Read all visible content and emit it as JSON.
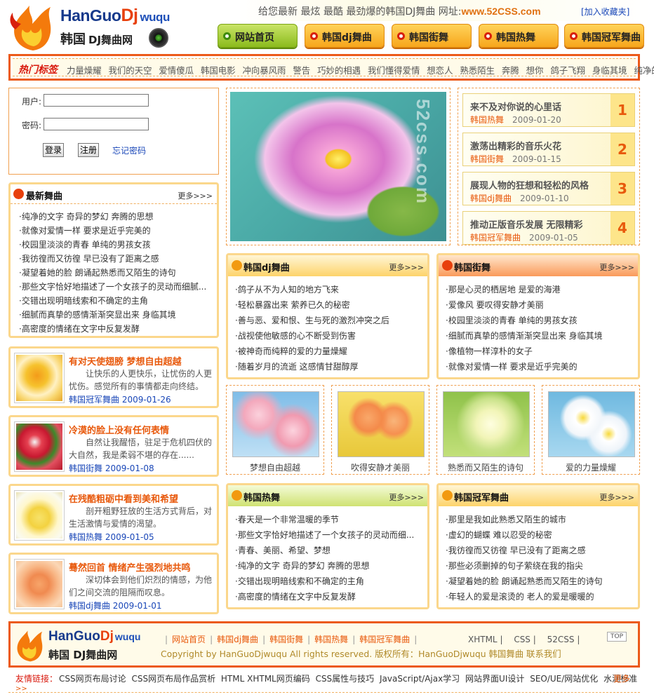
{
  "header": {
    "logo_en_main": "HanGuo",
    "logo_en_dj": "Dj",
    "logo_en_tail": "wuqu",
    "logo_cn": "韩国",
    "logo_cn_small": "DJ舞曲网",
    "slogan": "给您最新 最炫 最酷 最劲爆的韩国DJ舞曲  网址:",
    "site_url": "www.52CSS.com",
    "favorite": "[加入收藏夹]"
  },
  "nav": {
    "items": [
      {
        "label": "网站首页",
        "active": true
      },
      {
        "label": "韩国dj舞曲",
        "active": false
      },
      {
        "label": "韩国街舞",
        "active": false
      },
      {
        "label": "韩国热舞",
        "active": false
      },
      {
        "label": "韩国冠军舞曲",
        "active": false
      }
    ]
  },
  "hot_tags": {
    "title": "热门标签",
    "tags": [
      "力量燥耀",
      "我们的天空",
      "爱情傻瓜",
      "韩国电影",
      "冲向暴风雨",
      "警告",
      "巧妙的相遇",
      "我们懂得爱情",
      "想恋人",
      "熟悉陌生",
      "奔腾",
      "想你",
      "鸽子飞翔",
      "身临其境",
      "纯净的文字"
    ]
  },
  "login": {
    "user_label": "用户:",
    "pass_label": "密码:",
    "login_btn": "登录",
    "register_btn": "注册",
    "forgot": "忘记密码"
  },
  "latest": {
    "title": "最新舞曲",
    "more": "更多>>>",
    "items": [
      "·纯净的文字 奇异的梦幻 奔腾的思想",
      "·就像对爱情一样 要求是近乎完美的",
      "·校园里淡淡的青春 单纯的男孩女孩",
      "·我彷徨而又彷徨 早已没有了距离之感",
      "·凝望着她的脸 朗诵起熟悉而又陌生的诗句",
      "·那些文字恰好地描述了一个女孩子的灵动而细腻...",
      "·交错出现明暗线索和不确定的主角",
      "·细腻而真挚的感情渐渐突显出来 身临其境",
      "·高密度的情绪在文字中反复发酵"
    ]
  },
  "features": [
    {
      "title": "有对天使翅膀 梦想自由超越",
      "desc": "让快乐的人更快乐，让忧伤的人更忧伤。感觉所有的事情都走向终结。",
      "category": "韩国冠军舞曲",
      "date": "2009-01-26"
    },
    {
      "title": "冷漠的脸上没有任何表情",
      "desc": "自然让我醒悟，驻足于危机四伏的大自然，我是柔弱不堪的存在......",
      "category": "韩国街舞",
      "date": "2009-01-08"
    },
    {
      "title": "在残酷粗砺中看到美和希望",
      "desc": "剖开粗野狂放的生活方式背后，对生活激情与爱情的渴望。",
      "category": "韩国热舞",
      "date": "2009-01-05"
    },
    {
      "title": "蓦然回首 情绪产生强烈地共鸣",
      "desc": "深切体会到他们炽烈的情感，为他们之间交流的阻隔而叹息。",
      "category": "韩国dj舞曲",
      "date": "2009-01-01"
    }
  ],
  "big_photo": {
    "watermark": "52css.com"
  },
  "ranks": [
    {
      "title": "来不及对你说的心里话",
      "category": "韩国热舞",
      "date": "2009-01-20",
      "num": "1"
    },
    {
      "title": "激荡出精彩的音乐火花",
      "category": "韩国街舞",
      "date": "2009-01-15",
      "num": "2"
    },
    {
      "title": "展现人物的狂想和轻松的风格",
      "category": "韩国dj舞曲",
      "date": "2009-01-10",
      "num": "3"
    },
    {
      "title": "推动正版音乐发展 无限精彩",
      "category": "韩国冠军舞曲",
      "date": "2009-01-05",
      "num": "4"
    }
  ],
  "boxes": {
    "dj": {
      "title": "韩国dj舞曲",
      "more": "更多>>>",
      "items": [
        "·鸽子从不为人知的地方飞来",
        "·轻松暴露出来 萦养已久的秘密",
        "·善与恶、爱和恨、生与死的激烈冲突之后",
        "·战视使他敏感的心不断受到伤害",
        "·被神奇而纯粹的爱的力量燥耀",
        "·随着岁月的流逝 这感情甘甜醇厚"
      ]
    },
    "street": {
      "title": "韩国街舞",
      "more": "更多>>>",
      "items": [
        "·那是心灵的栖居地 是爱的海港",
        "·爱像风 要叹得安静才美丽",
        "·校园里淡淡的青春 单纯的男孩女孩",
        "·细腻而真挚的感情渐渐突显出来 身临其境",
        "·像植物一样淳朴的女子",
        "·就像对爱情一样 要求是近乎完美的"
      ]
    },
    "hot": {
      "title": "韩国热舞",
      "more": "更多>>>",
      "items": [
        "·春天是一个非常温暖的季节",
        "·那些文字恰好地描述了一个女孩子的灵动而细...",
        "·青春、美丽、希望、梦想",
        "·纯净的文字 奇异的梦幻 奔腾的思想",
        "·交错出现明暗线索和不确定的主角",
        "·高密度的情绪在文字中反复发酵"
      ]
    },
    "champ": {
      "title": "韩国冠军舞曲",
      "more": "更多>>>",
      "items": [
        "·那里是我如此熟悉又陌生的城市",
        "·虚幻的蝴蝶 难以忍受的秘密",
        "·我彷徨而又彷徨 早已没有了距离之感",
        "·那些必须删掉的句子萦绕在我的指尖",
        "·凝望着她的脸 朗诵起熟悉而又陌生的诗句",
        "·年轻人的爱是滚烫的 老人的爱是暖暖的"
      ]
    }
  },
  "photos": [
    {
      "caption": "梦想自由超越"
    },
    {
      "caption": "吹得安静才美丽"
    },
    {
      "caption": "熟悉而又陌生的诗句"
    },
    {
      "caption": "爱的力量燥耀"
    }
  ],
  "footer": {
    "links": [
      "网站首页",
      "韩国dj舞曲",
      "韩国街舞",
      "韩国热舞",
      "韩国冠军舞曲"
    ],
    "copyright": "Copyright by HanGuoDjwuqu All rights reserved. 版权所有：HanGuoDjwuqu 韩国舞曲 联系我们",
    "std": [
      "XHTML",
      "CSS",
      "52CSS"
    ],
    "top": "TOP"
  },
  "friend": {
    "title": "友情链接：",
    "links": [
      "CSS网页布局讨论",
      "CSS网页布局作品赏析",
      "HTML XHTML网页编码",
      "CSS属性与技巧",
      "JavaScript/Ajax学习",
      "网站界面UI设计",
      "SEO/UE/网站优化",
      "水润标准"
    ],
    "more": "更多",
    "arrows": ">>"
  }
}
